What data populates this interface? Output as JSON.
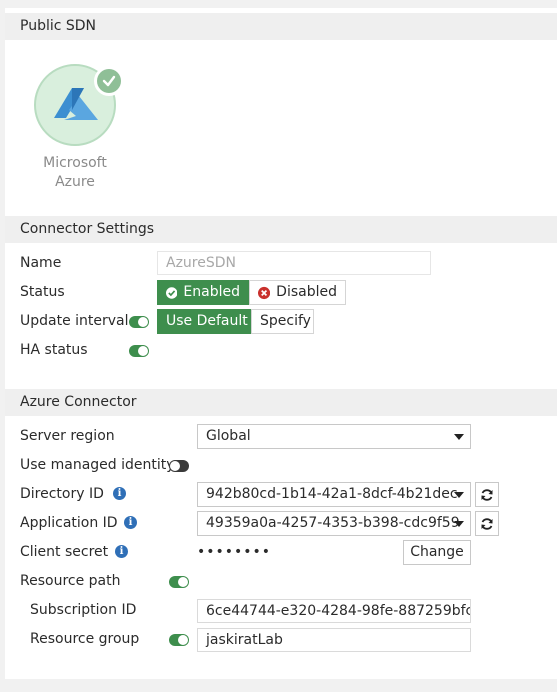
{
  "public_sdn": {
    "header": "Public SDN",
    "connector_card": {
      "line1": "Microsoft",
      "line2": "Azure",
      "icon": "azure-logo-icon",
      "selected": true
    }
  },
  "connector_settings": {
    "header": "Connector Settings",
    "name_label": "Name",
    "name_value": "AzureSDN",
    "status_label": "Status",
    "status_enabled": "Enabled",
    "status_disabled": "Disabled",
    "update_interval_label": "Update interval",
    "update_use_default": "Use Default",
    "update_specify": "Specify",
    "ha_status_label": "HA status"
  },
  "azure_connector": {
    "header": "Azure Connector",
    "server_region_label": "Server region",
    "server_region_value": "Global",
    "use_managed_identity_label": "Use managed identity",
    "directory_id_label": "Directory ID",
    "directory_id_value": "942b80cd-1b14-42a1-8dcf-4b21dec",
    "application_id_label": "Application ID",
    "application_id_value": "49359a0a-4257-4353-b398-cdc9f59",
    "client_secret_label": "Client secret",
    "client_secret_value": "••••••••",
    "change_button": "Change",
    "resource_path_label": "Resource path",
    "subscription_id_label": "Subscription ID",
    "subscription_id_value": "6ce44744-e320-4284-98fe-887259bfc",
    "resource_group_label": "Resource group",
    "resource_group_value": "jaskiratLab"
  },
  "colors": {
    "accent_green": "#3e8e4d",
    "info_blue": "#2f6fb7",
    "disabled_red": "#c9302c",
    "azure_blue": "#3c8fd1"
  }
}
